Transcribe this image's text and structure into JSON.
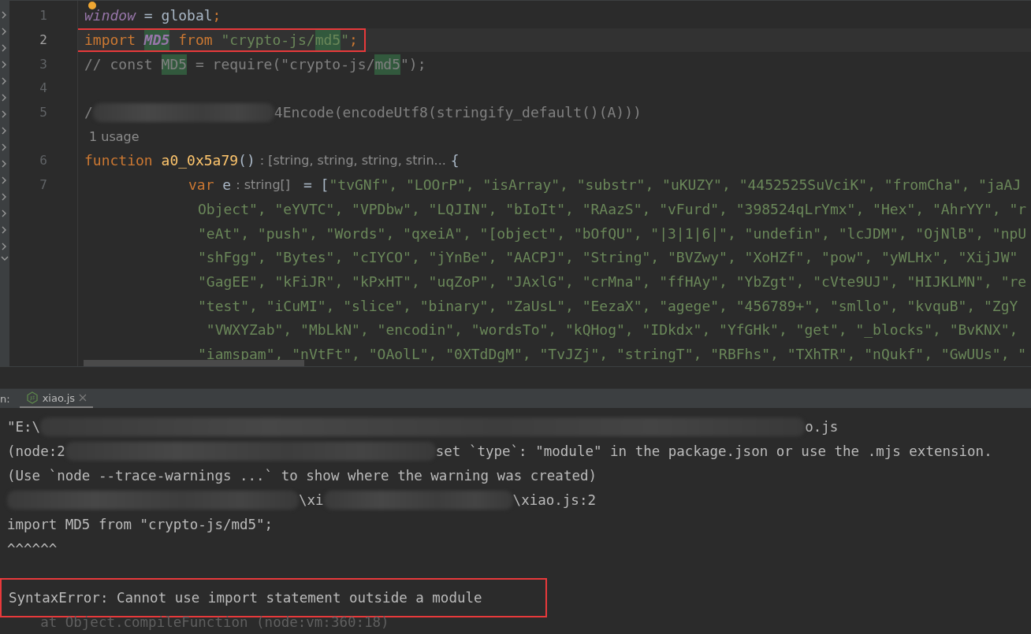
{
  "editor": {
    "lines": [
      {
        "kind": "code",
        "number": "1",
        "current": false,
        "boxed": false,
        "tokens": [
          {
            "kind": "var",
            "text": "window"
          },
          {
            "kind": "plain",
            "text": " = global"
          },
          {
            "kind": "keyword",
            "text": ";"
          }
        ]
      },
      {
        "kind": "code",
        "number": "2",
        "current": true,
        "boxed": true,
        "tokens": [
          {
            "kind": "keyword",
            "text": "import "
          },
          {
            "kind": "var",
            "text": "MD5",
            "match": true
          },
          {
            "kind": "keyword",
            "text": " from "
          },
          {
            "kind": "string",
            "text": "\"crypto-js/"
          },
          {
            "kind": "string",
            "text": "md5",
            "match": true
          },
          {
            "kind": "string",
            "text": "\""
          },
          {
            "kind": "keyword",
            "text": ";"
          }
        ]
      },
      {
        "kind": "code",
        "number": "3",
        "current": false,
        "boxed": false,
        "tokens": [
          {
            "kind": "comment",
            "text": "// const "
          },
          {
            "kind": "comment",
            "text": "MD5",
            "match": true
          },
          {
            "kind": "comment",
            "text": " = require(\"crypto-js/"
          },
          {
            "kind": "comment",
            "text": "md5",
            "match": true
          },
          {
            "kind": "comment",
            "text": "\");"
          }
        ]
      },
      {
        "kind": "code",
        "number": "4",
        "current": false,
        "boxed": false
      },
      {
        "kind": "code",
        "number": "5",
        "current": false,
        "boxed": false,
        "tokens": [
          {
            "kind": "comment",
            "text": "/"
          },
          {
            "kind": "blur"
          },
          {
            "kind": "comment",
            "text": "4Encode(encodeUtf8(stringify_default()(A)))"
          }
        ]
      },
      {
        "kind": "usage",
        "boxed": false,
        "tokens": [
          {
            "kind": "hint",
            "text": "1 usage"
          }
        ]
      },
      {
        "kind": "code",
        "number": "6",
        "current": false,
        "boxed": false,
        "tokens": [
          {
            "kind": "keyword",
            "text": "function "
          },
          {
            "kind": "func",
            "text": "a0_0x5a79"
          },
          {
            "kind": "plain",
            "text": "()"
          },
          {
            "kind": "hint",
            "text": ": [string, string, string, strin..."
          },
          {
            "kind": "plain",
            "text": "{"
          }
        ]
      },
      {
        "kind": "nested",
        "number": "7",
        "current": false,
        "boxed": false,
        "tokens": [
          {
            "kind": "keyword",
            "text": "var"
          },
          {
            "kind": "plain",
            "text": " e"
          },
          {
            "kind": "hint",
            "text": ": string[]"
          },
          {
            "kind": "plain",
            "text": " = ["
          },
          {
            "kind": "string",
            "text": "\"tvGNf\", \"LOOrP\", \"isArray\", \"substr\", \"uKUZY\", \"4452525SuVciK\", \"fromCha\", \"jaAJ"
          }
        ]
      },
      {
        "kind": "wrapped",
        "boxed": false,
        "tokens": [
          {
            "kind": "string",
            "text": "Object\", \"eYVTC\", \"VPDbw\", \"LQJIN\", \"bIoIt\", \"RAazS\", \"vFurd\", \"398524qLrYmx\", \"Hex\", \"AhrYY\", \"r"
          }
        ]
      },
      {
        "kind": "wrapped",
        "boxed": false,
        "tokens": [
          {
            "kind": "string",
            "text": "\"eAt\", \"push\", \"Words\", \"qxeiA\", \"[object\", \"bOfQU\", \"|3|1|6|\", \"undefin\", \"lcJDM\", \"OjNlB\", \"npU"
          }
        ]
      },
      {
        "kind": "wrapped",
        "boxed": false,
        "tokens": [
          {
            "kind": "string",
            "text": "\"shFgg\", \"Bytes\", \"cIYCO\", \"jYnBe\", \"AACPJ\", \"String\", \"BVZwy\", \"XoHZf\", \"pow\", \"yWLHx\", \"XijJW\""
          }
        ]
      },
      {
        "kind": "wrapped",
        "boxed": false,
        "tokens": [
          {
            "kind": "string",
            "text": "\"GagEE\", \"kFiJR\", \"kPxHT\", \"uqZoP\", \"JAxlG\", \"crMna\", \"ffHAy\", \"YbZgt\", \"cVte9UJ\", \"HIJKLMN\", \"re"
          }
        ]
      },
      {
        "kind": "wrapped",
        "boxed": false,
        "tokens": [
          {
            "kind": "string",
            "text": "\"test\", \"iCuMI\", \"slice\", \"binary\", \"ZaUsL\", \"EezaX\", \"agege\", \"456789+\", \"smllo\", \"kvquB\", \"ZgY"
          }
        ]
      },
      {
        "kind": "wrapped",
        "boxed": false,
        "tokens": [
          {
            "kind": "string",
            "text": " \"VWXYZab\", \"MbLkN\", \"encodin\", \"wordsTo\", \"kQHog\", \"IDkdx\", \"YfGHk\", \"get\", \"_blocks\", \"BvKNX\","
          }
        ]
      },
      {
        "kind": "wrapped",
        "boxed": false,
        "tokens": [
          {
            "kind": "string",
            "text": "\"iamspam\", \"nVtFt\", \"OAolL\", \"0XTdDgM\", \"TvJZj\", \"stringT\", \"RBFhs\", \"TXhTR\", \"nQukf\", \"GwUUs\", \""
          }
        ]
      }
    ]
  },
  "run_panel": {
    "label": "n:",
    "tabs": [
      {
        "label": "xiao.js",
        "selected": true
      }
    ],
    "lines": [
      {
        "kind": "output",
        "boxed": false,
        "parts": [
          {
            "kind": "text",
            "text": "\"E:\\"
          },
          {
            "kind": "blur"
          },
          {
            "kind": "text",
            "text": "o.js"
          }
        ]
      },
      {
        "kind": "output",
        "boxed": false,
        "parts": [
          {
            "kind": "text",
            "text": "(node:2"
          },
          {
            "kind": "blur"
          },
          {
            "kind": "text",
            "text": "set `type`: \"module\" in the package.json or use the .mjs extension."
          }
        ]
      },
      {
        "kind": "output",
        "boxed": false,
        "parts": [
          {
            "kind": "text",
            "text": "(Use `node --trace-warnings ...` to show where the warning was created)"
          }
        ]
      },
      {
        "kind": "output",
        "boxed": false,
        "parts": [
          {
            "kind": "blur"
          },
          {
            "kind": "text",
            "text": "\\xi"
          },
          {
            "kind": "blur"
          },
          {
            "kind": "text",
            "text": "\\xiao.js:2"
          }
        ]
      },
      {
        "kind": "output",
        "boxed": false,
        "parts": [
          {
            "kind": "text",
            "text": "import MD5 from \"crypto-js/md5\";"
          }
        ]
      },
      {
        "kind": "output",
        "boxed": false,
        "parts": [
          {
            "kind": "text",
            "text": "^^^^^^"
          }
        ]
      },
      {
        "kind": "blank",
        "boxed": false
      },
      {
        "kind": "output",
        "boxed": true,
        "parts": [
          {
            "kind": "text",
            "text": "SyntaxError: Cannot use import statement outside a module"
          }
        ]
      },
      {
        "kind": "trace",
        "boxed": false,
        "parts": [
          {
            "kind": "text",
            "text": "    at Object.compileFunction (node:vm:360:18)"
          }
        ]
      }
    ]
  }
}
